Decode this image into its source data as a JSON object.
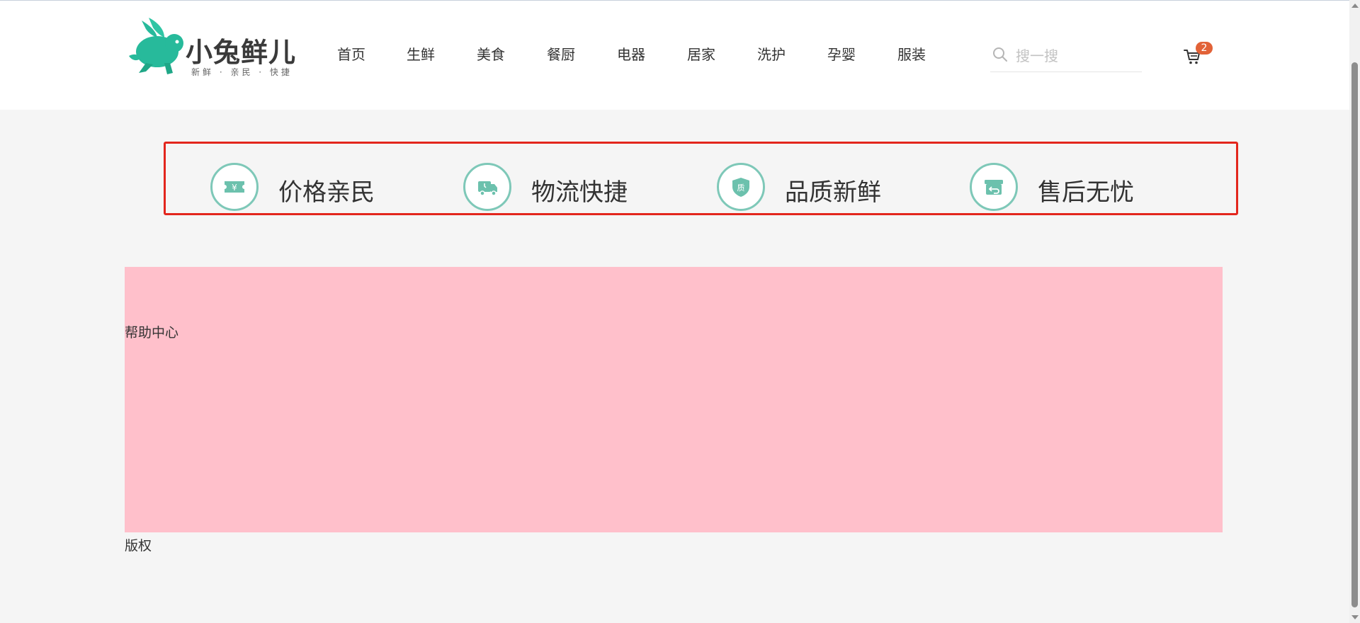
{
  "header": {
    "logo_title": "小兔鲜儿",
    "logo_subtitle": "新鲜 · 亲民 · 快捷",
    "nav": [
      "首页",
      "生鲜",
      "美食",
      "餐厨",
      "电器",
      "居家",
      "洗护",
      "孕婴",
      "服装"
    ],
    "search": {
      "placeholder": "搜一搜",
      "value": ""
    },
    "cart": {
      "count": "2"
    }
  },
  "services": [
    {
      "label": "价格亲民",
      "icon": "price-tag-icon"
    },
    {
      "label": "物流快捷",
      "icon": "delivery-truck-icon"
    },
    {
      "label": "品质新鲜",
      "icon": "quality-shield-icon"
    },
    {
      "label": "售后无忧",
      "icon": "return-box-icon"
    }
  ],
  "help": {
    "label": "帮助中心"
  },
  "footer": {
    "copyright": "版权"
  },
  "colors": {
    "brand_green": "#27ba9b",
    "icon_ring": "#7ec8b8",
    "badge": "#e26237",
    "highlight_border": "#e3261d",
    "help_bg": "#ffc0cb"
  }
}
